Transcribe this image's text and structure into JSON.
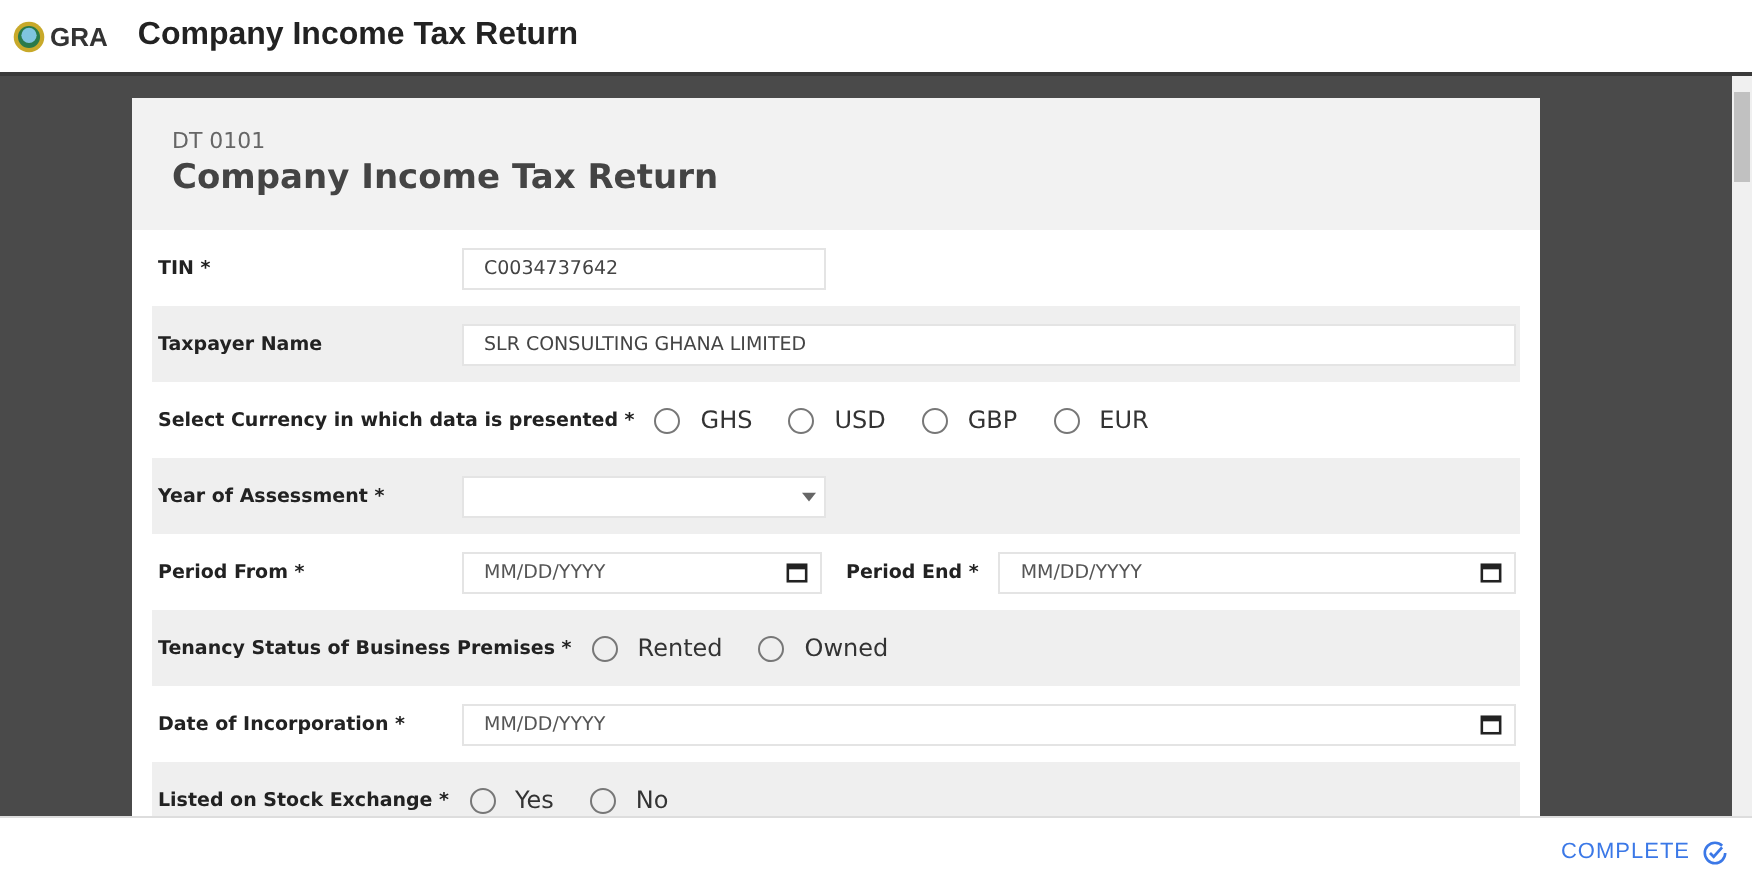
{
  "app_bar": {
    "logo_text": "GRA",
    "title": "Company Income Tax Return"
  },
  "form": {
    "code": "DT 0101",
    "title": "Company Income Tax Return",
    "rows": [
      {
        "kind": "short_text",
        "label": "TIN *",
        "value": "C0034737642"
      },
      {
        "kind": "long_text",
        "label": "Taxpayer Name",
        "value": "SLR CONSULTING GHANA LIMITED"
      },
      {
        "kind": "radio",
        "label": "Select Currency in which data is presented *",
        "options": [
          {
            "label": "GHS",
            "selected": false
          },
          {
            "label": "USD",
            "selected": false
          },
          {
            "label": "GBP",
            "selected": false
          },
          {
            "label": "EUR",
            "selected": false
          }
        ]
      },
      {
        "kind": "select",
        "label": "Year of Assessment *"
      },
      {
        "kind": "daterange",
        "label": "Period From *",
        "placeholder": "MM/DD/YYYY",
        "label_2": "Period End *",
        "placeholder_2": "MM/DD/YYYY"
      },
      {
        "kind": "radio",
        "label": "Tenancy Status of Business Premises *",
        "options": [
          {
            "label": "Rented",
            "selected": false
          },
          {
            "label": "Owned",
            "selected": false
          }
        ]
      },
      {
        "kind": "date",
        "label": "Date of Incorporation *",
        "placeholder": "MM/DD/YYYY"
      },
      {
        "kind": "radio",
        "label": "Listed on Stock Exchange *",
        "options": [
          {
            "label": "Yes",
            "selected": false
          },
          {
            "label": "No",
            "selected": false
          }
        ]
      }
    ]
  },
  "footer": {
    "complete_button": "COMPLETE"
  }
}
